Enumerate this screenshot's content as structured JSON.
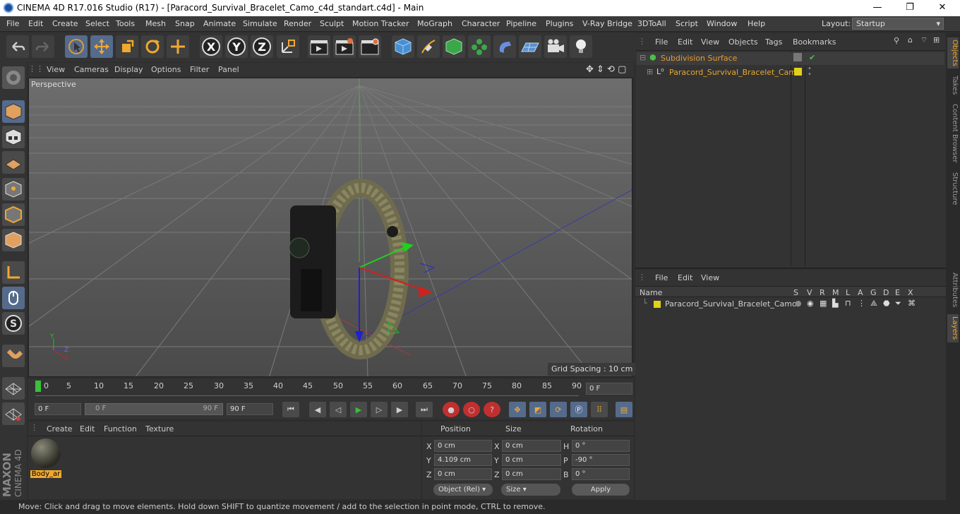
{
  "window": {
    "title": "CINEMA 4D R17.016 Studio (R17) - [Paracord_Survival_Bracelet_Camo_c4d_standart.c4d] - Main",
    "minimize": "—",
    "maximize": "❐",
    "close": "✕"
  },
  "menubar": [
    "File",
    "Edit",
    "Create",
    "Select",
    "Tools",
    "Mesh",
    "Snap",
    "Animate",
    "Simulate",
    "Render",
    "Sculpt",
    "Motion Tracker",
    "MoGraph",
    "Character",
    "Pipeline",
    "Plugins",
    "V-Ray Bridge",
    "3DToAll",
    "Script",
    "Window",
    "Help"
  ],
  "layout": {
    "label": "Layout:",
    "value": "Startup"
  },
  "toolbar": {
    "x_axis": "X",
    "y_axis": "Y",
    "z_axis": "Z"
  },
  "viewport": {
    "menu": [
      "View",
      "Cameras",
      "Display",
      "Options",
      "Filter",
      "Panel"
    ],
    "label": "Perspective",
    "grid_spacing": "Grid Spacing : 10 cm"
  },
  "timeline": {
    "ticks": [
      "0",
      "5",
      "10",
      "15",
      "20",
      "25",
      "30",
      "35",
      "40",
      "45",
      "50",
      "55",
      "60",
      "65",
      "70",
      "75",
      "80",
      "85",
      "90"
    ],
    "current_frame": "0 F"
  },
  "playback": {
    "start": "0 F",
    "range_start": "0 F",
    "range_end": "90 F",
    "end": "90 F"
  },
  "materials": {
    "menu": [
      "Create",
      "Edit",
      "Function",
      "Texture"
    ],
    "items": [
      {
        "name": "Body_ar"
      }
    ]
  },
  "coordinates": {
    "headers": {
      "position": "Position",
      "size": "Size",
      "rotation": "Rotation"
    },
    "rows": [
      {
        "axis": "X",
        "pos": "0 cm",
        "size_axis": "X",
        "size": "0 cm",
        "rot_axis": "H",
        "rot": "0 °"
      },
      {
        "axis": "Y",
        "pos": "4.109 cm",
        "size_axis": "Y",
        "size": "0 cm",
        "rot_axis": "P",
        "rot": "-90 °"
      },
      {
        "axis": "Z",
        "pos": "0 cm",
        "size_axis": "Z",
        "size": "0 cm",
        "rot_axis": "B",
        "rot": "0 °"
      }
    ],
    "mode": "Object (Rel)",
    "size_mode": "Size",
    "apply": "Apply"
  },
  "objects_panel": {
    "menu": [
      "File",
      "Edit",
      "View",
      "Objects",
      "Tags",
      "Bookmarks"
    ],
    "items": [
      {
        "name": "Subdivision Surface",
        "color": "#e89a2e"
      },
      {
        "name": "Paracord_Survival_Bracelet_Camo",
        "color": "#e8a830"
      }
    ]
  },
  "layers_panel": {
    "menu": [
      "File",
      "Edit",
      "View"
    ],
    "columns": {
      "name": "Name",
      "flags": [
        "S",
        "V",
        "R",
        "M",
        "L",
        "A",
        "G",
        "D",
        "E",
        "X"
      ]
    },
    "items": [
      {
        "name": "Paracord_Survival_Bracelet_Camo",
        "color": "#e0d21c"
      }
    ]
  },
  "side_tabs": [
    "Objects",
    "Takes",
    "Content Browser",
    "Structure",
    "Attributes",
    "Layers"
  ],
  "status": "Move: Click and drag to move elements. Hold down SHIFT to quantize movement / add to the selection in point mode, CTRL to remove.",
  "logo": {
    "brand": "MAXON",
    "product": "CINEMA 4D"
  }
}
